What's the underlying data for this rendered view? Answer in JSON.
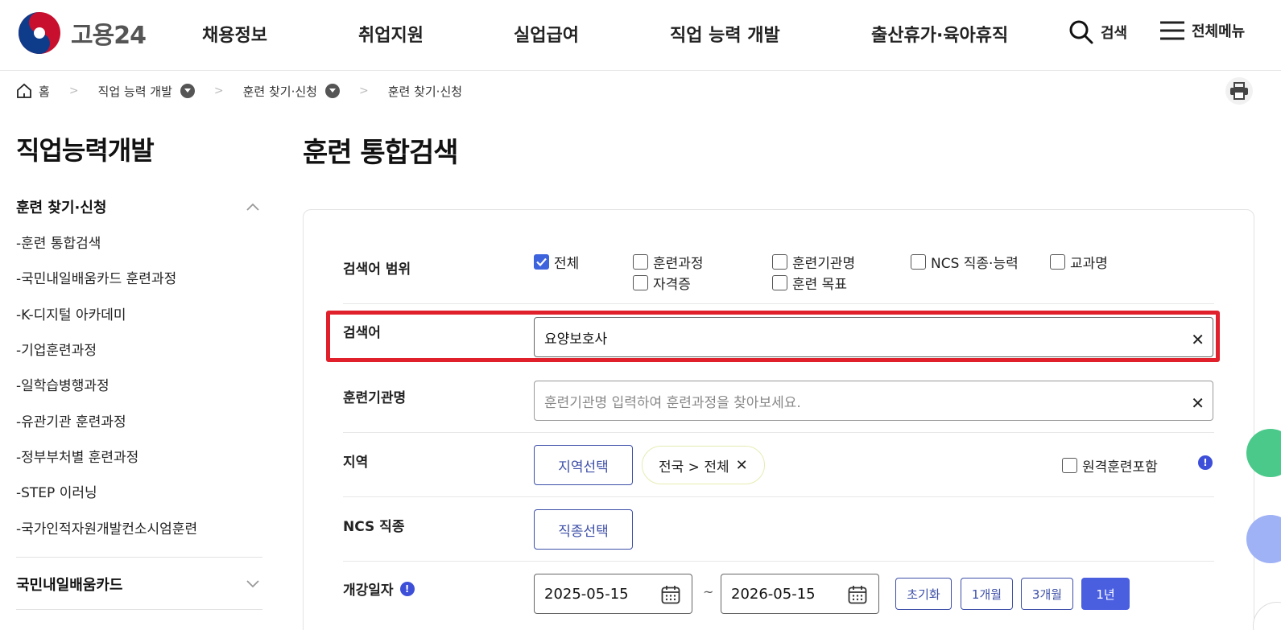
{
  "header": {
    "logo_text": "고용24",
    "nav": [
      "채용정보",
      "취업지원",
      "실업급여",
      "직업 능력 개발",
      "출산휴가·육아휴직"
    ],
    "search_label": "검색",
    "menu_label": "전체메뉴"
  },
  "breadcrumb": {
    "home": "홈",
    "level1": "직업 능력 개발",
    "level2": "훈련 찾기·신청",
    "level3": "훈련 찾기·신청"
  },
  "sidebar": {
    "title": "직업능력개발",
    "section1": "훈련 찾기·신청",
    "items": [
      "-훈련 통합검색",
      "-국민내일배움카드 훈련과정",
      "-K-디지털 아카데미",
      "-기업훈련과정",
      "-일학습병행과정",
      "-유관기관 훈련과정",
      "-정부부처별 훈련과정",
      "-STEP 이러닝",
      "-국가인적자원개발컨소시엄훈련"
    ],
    "section2": "국민내일배움카드"
  },
  "main": {
    "title": "훈련 통합검색",
    "scope": {
      "label": "검색어 범위",
      "options": [
        {
          "label": "전체",
          "checked": true
        },
        {
          "label": "훈련과정",
          "checked": false
        },
        {
          "label": "훈련기관명",
          "checked": false
        },
        {
          "label": "NCS 직종·능력",
          "checked": false
        },
        {
          "label": "교과명",
          "checked": false
        },
        {
          "label": "자격증",
          "checked": false
        },
        {
          "label": "훈련 목표",
          "checked": false
        }
      ]
    },
    "keyword": {
      "label": "검색어",
      "value": "요양보호사"
    },
    "institution": {
      "label": "훈련기관명",
      "placeholder": "훈련기관명 입력하여 훈련과정을 찾아보세요."
    },
    "region": {
      "label": "지역",
      "button": "지역선택",
      "tag": "전국 > 전체",
      "remote_label": "원격훈련포함"
    },
    "ncs": {
      "label": "NCS 직종",
      "button": "직종선택"
    },
    "start_date": {
      "label": "개강일자",
      "from": "2025-05-15",
      "tilde": "~",
      "to": "2026-05-15",
      "buttons": [
        "초기화",
        "1개월",
        "3개월",
        "1년"
      ],
      "active_index": 3
    }
  },
  "colors": {
    "accent": "#3d4fa8",
    "highlight": "#e0212b",
    "checkbox": "#3d63dd"
  }
}
